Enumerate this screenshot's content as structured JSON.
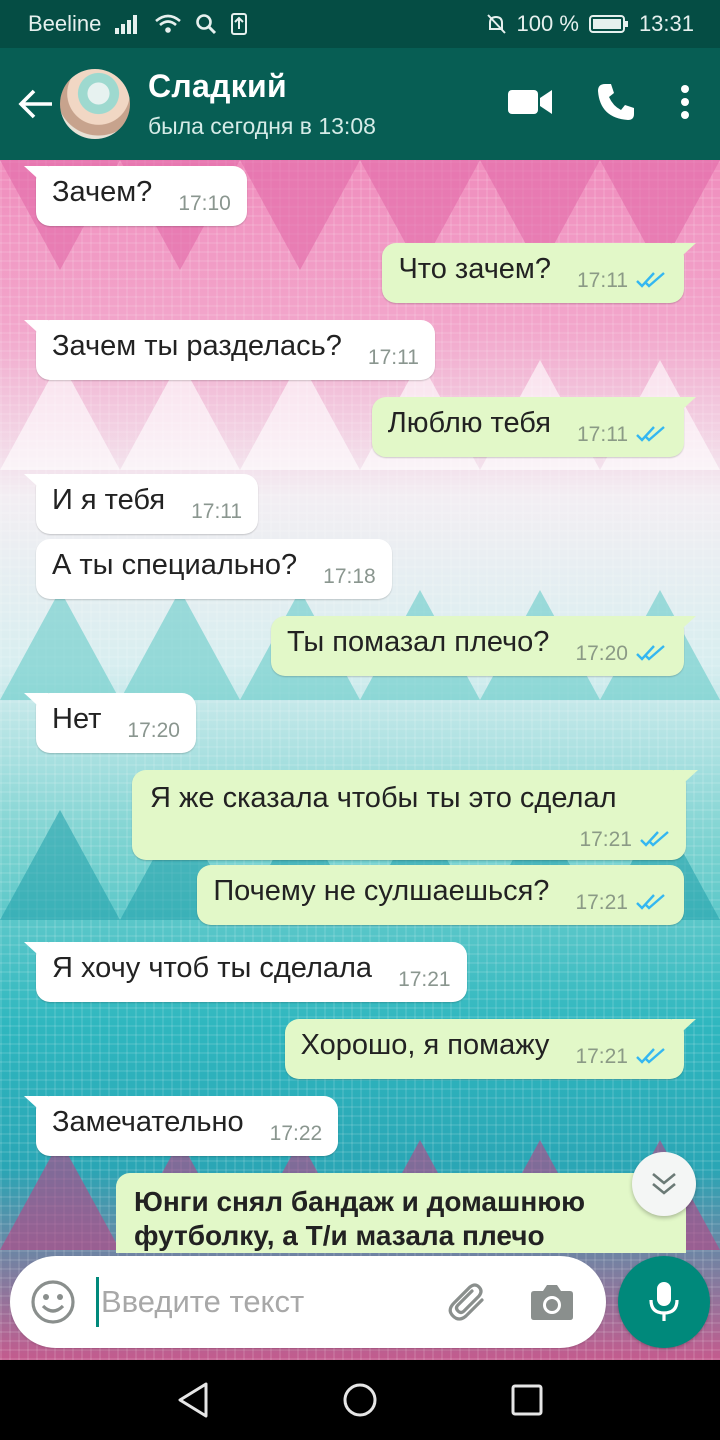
{
  "status_bar": {
    "carrier": "Beeline",
    "battery": "100 %",
    "time": "13:31"
  },
  "header": {
    "contact_name": "Сладкий",
    "contact_status": "была сегодня в 13:08"
  },
  "messages": [
    {
      "dir": "in",
      "text": "Зачем?",
      "time": "17:10"
    },
    {
      "dir": "out",
      "text": "Что зачем?",
      "time": "17:11",
      "read": true
    },
    {
      "dir": "in",
      "text": "Зачем ты разделась?",
      "time": "17:11"
    },
    {
      "dir": "out",
      "text": "Люблю тебя",
      "time": "17:11",
      "read": true
    },
    {
      "dir": "in",
      "text": "И я тебя",
      "time": "17:11"
    },
    {
      "dir": "in",
      "text": "А ты специально?",
      "time": "17:18"
    },
    {
      "dir": "out",
      "text": "Ты помазал плечо?",
      "time": "17:20",
      "read": true
    },
    {
      "dir": "in",
      "text": "Нет",
      "time": "17:20"
    },
    {
      "dir": "out",
      "text": "Я же сказала чтобы ты это сделал",
      "time": "17:21",
      "read": true
    },
    {
      "dir": "out",
      "text": "Почему не сулшаешься?",
      "time": "17:21",
      "read": true
    },
    {
      "dir": "in",
      "text": "Я хочу чтоб ты сделала",
      "time": "17:21"
    },
    {
      "dir": "out",
      "text": "Хорошо, я помажу",
      "time": "17:21",
      "read": true
    },
    {
      "dir": "in",
      "text": "Замечательно",
      "time": "17:22"
    },
    {
      "dir": "out",
      "text_line1": "Юнги снял бандаж и домашнюю",
      "text_line2": "футболку, а Т/и мазала плечо"
    }
  ],
  "composer": {
    "placeholder": "Введите текст"
  },
  "colors": {
    "header": "#075e54",
    "status_bar": "#054d44",
    "outgoing_bubble": "#e2f8c8",
    "incoming_bubble": "#ffffff",
    "read_ticks": "#34b7f1",
    "mic_button": "#00897b"
  },
  "icons": {
    "back": "arrow-left-icon",
    "video": "video-camera-icon",
    "call": "phone-icon",
    "menu": "more-vertical-icon",
    "emoji": "smiley-icon",
    "attach": "paperclip-icon",
    "camera": "camera-icon",
    "mic": "microphone-icon",
    "scroll": "double-chevron-down-icon"
  }
}
